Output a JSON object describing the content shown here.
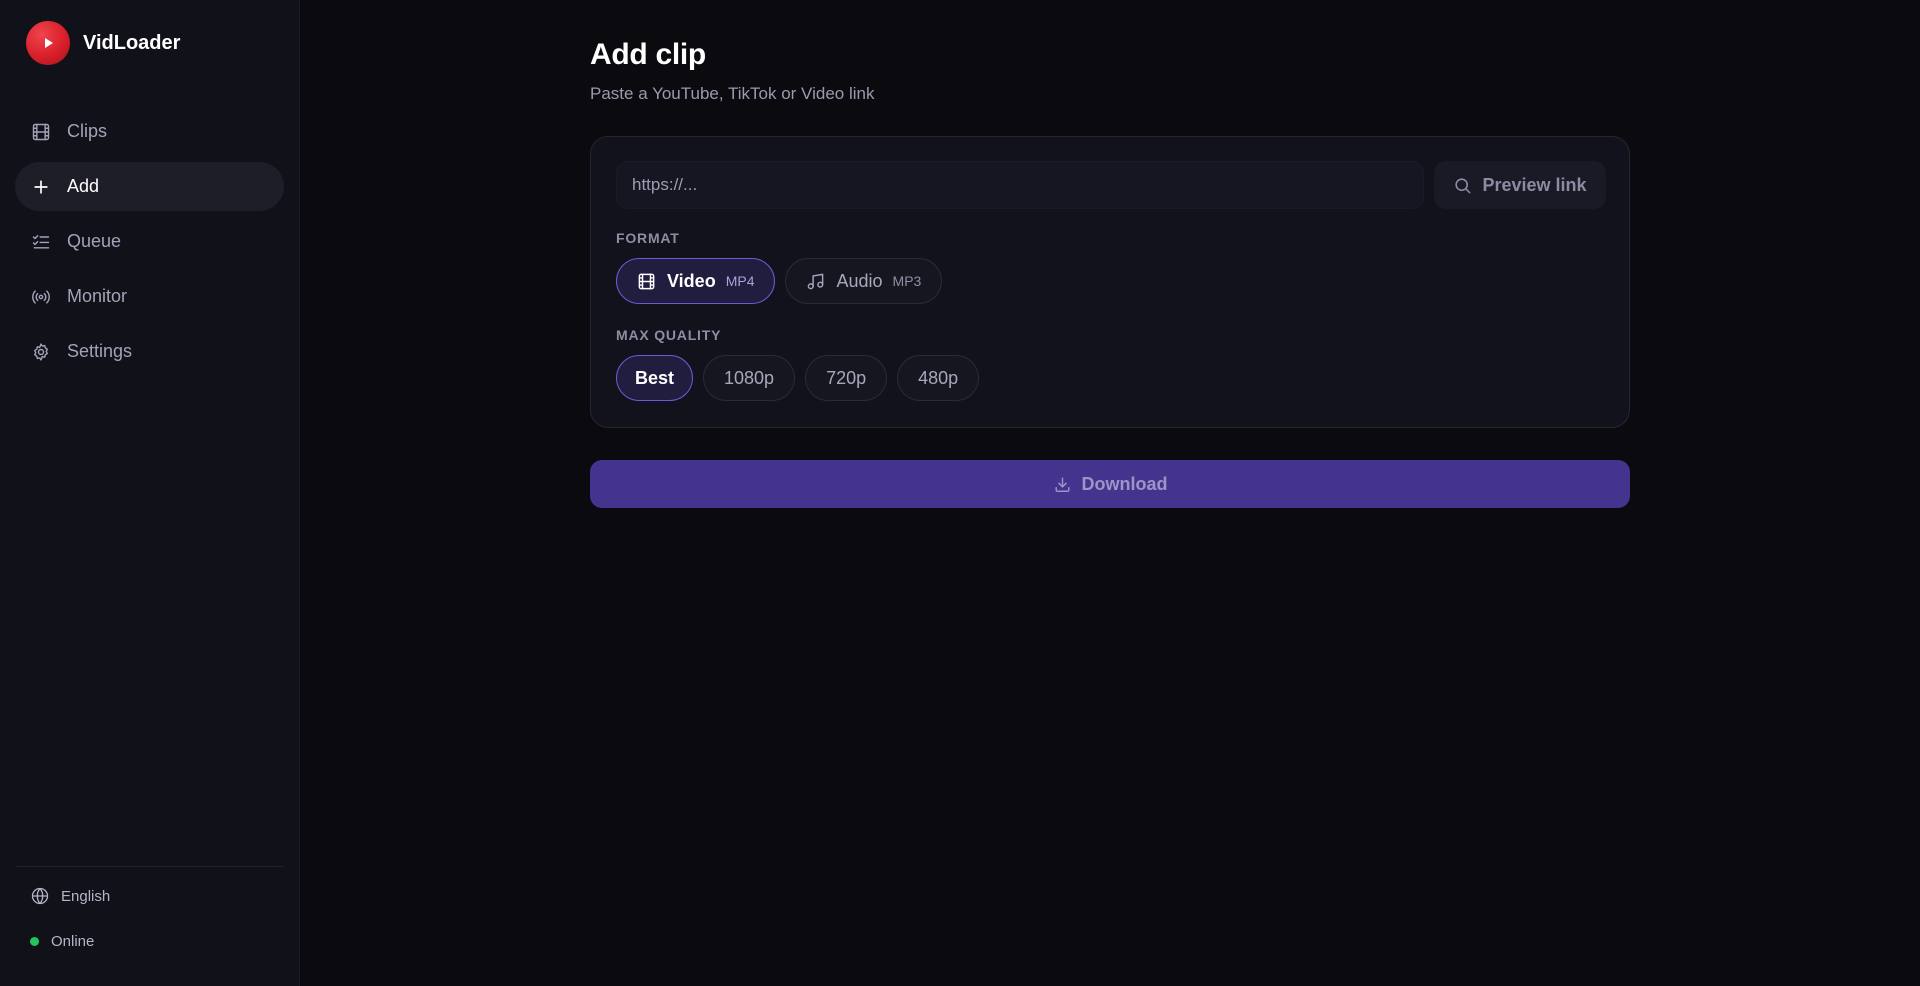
{
  "app": {
    "name": "VidLoader",
    "logo_icon": "play-icon",
    "brand_color": "#e02531"
  },
  "sidebar": {
    "items": [
      {
        "label": "Clips",
        "icon": "film-icon",
        "active": false
      },
      {
        "label": "Add",
        "icon": "plus-icon",
        "active": true
      },
      {
        "label": "Queue",
        "icon": "checklist-icon",
        "active": false
      },
      {
        "label": "Monitor",
        "icon": "broadcast-icon",
        "active": false
      },
      {
        "label": "Settings",
        "icon": "gear-icon",
        "active": false
      }
    ],
    "language": {
      "label": "English",
      "icon": "globe-icon"
    },
    "status": {
      "label": "Online",
      "color": "#22c55e"
    }
  },
  "main": {
    "title": "Add clip",
    "subtitle": "Paste a YouTube, TikTok or Video link",
    "url_input": {
      "placeholder": "https://...",
      "value": ""
    },
    "preview_button": {
      "label": "Preview link",
      "icon": "search-icon"
    },
    "format": {
      "label": "FORMAT",
      "options": [
        {
          "label": "Video",
          "sub": "MP4",
          "icon": "film-icon",
          "selected": true
        },
        {
          "label": "Audio",
          "sub": "MP3",
          "icon": "music-note-icon",
          "selected": false
        }
      ]
    },
    "quality": {
      "label": "MAX QUALITY",
      "options": [
        {
          "label": "Best",
          "selected": true
        },
        {
          "label": "1080p",
          "selected": false
        },
        {
          "label": "720p",
          "selected": false
        },
        {
          "label": "480p",
          "selected": false
        }
      ]
    },
    "download_button": {
      "label": "Download",
      "icon": "download-icon"
    }
  },
  "colors": {
    "accent": "#6d5bd6",
    "download_bg": "#45348e",
    "background": "#0a0a0f",
    "sidebar_bg": "#11111a"
  }
}
